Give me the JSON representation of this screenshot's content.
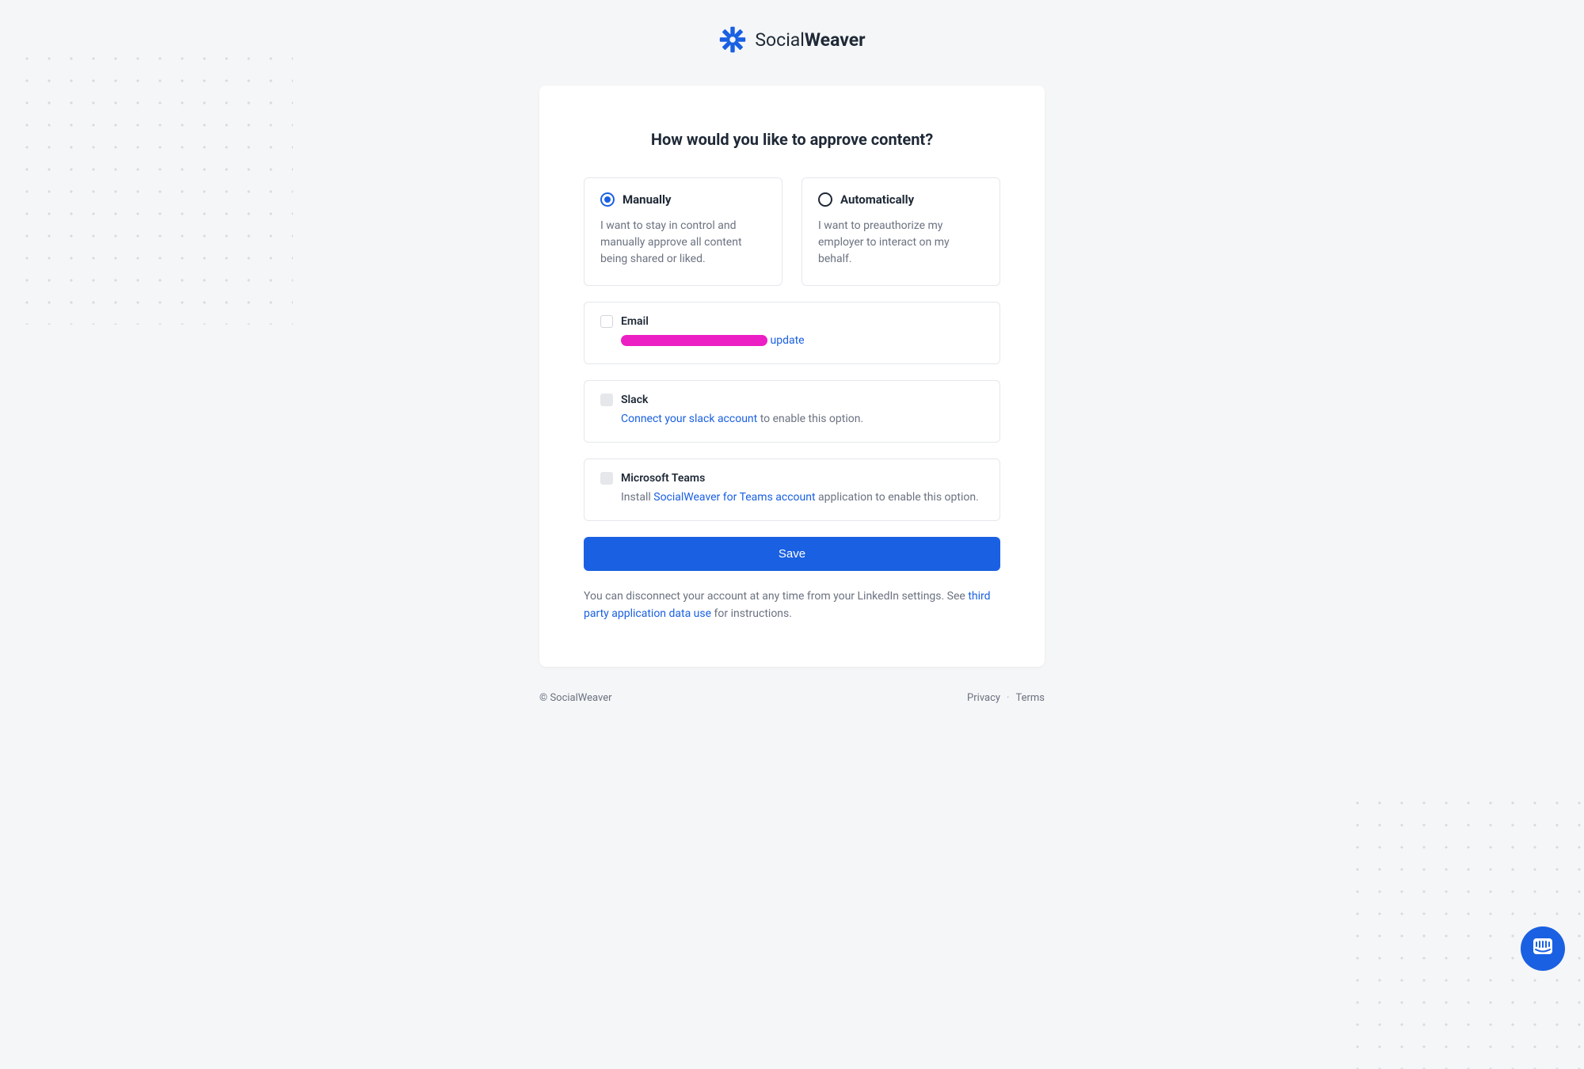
{
  "brand": {
    "name_light": "Social",
    "name_bold": "Weaver"
  },
  "page": {
    "title": "How would you like to approve content?"
  },
  "approval_options": {
    "manually": {
      "label": "Manually",
      "description": "I want to stay in control and manually approve all content being shared or liked.",
      "selected": true
    },
    "automatically": {
      "label": "Automatically",
      "description": "I want to preauthorize my employer to interact on my behalf.",
      "selected": false
    }
  },
  "channels": {
    "email": {
      "label": "Email",
      "update_link": "update"
    },
    "slack": {
      "label": "Slack",
      "connect_link": "Connect your slack account",
      "suffix": " to enable this option."
    },
    "teams": {
      "label": "Microsoft Teams",
      "prefix": "Install ",
      "install_link": "SocialWeaver for Teams account",
      "suffix": " application to enable this option."
    }
  },
  "buttons": {
    "save": "Save"
  },
  "disclaimer": {
    "text_before": "You can disconnect your account at any time from your LinkedIn settings. See ",
    "link": "third party application data use",
    "text_after": " for instructions."
  },
  "footer": {
    "copyright": "© SocialWeaver",
    "privacy": "Privacy",
    "terms": "Terms"
  }
}
